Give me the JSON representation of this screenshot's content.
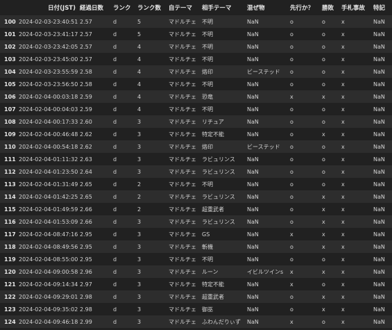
{
  "columns": [
    "",
    "日付(JST)",
    "経過日数",
    "ランク",
    "ランク数",
    "自テーマ",
    "相手テーマ",
    "混ぜ物",
    "先行か？",
    "勝敗",
    "手札事故",
    "特記"
  ],
  "rows": [
    [
      "100",
      "2024-02-03-23:40:51",
      "2.57",
      "d",
      "5",
      "マドルチェ",
      "不明",
      "NaN",
      "o",
      "o",
      "x",
      "NaN"
    ],
    [
      "101",
      "2024-02-03-23:41:17",
      "2.57",
      "d",
      "5",
      "マドルチェ",
      "不明",
      "NaN",
      "o",
      "o",
      "x",
      "NaN"
    ],
    [
      "102",
      "2024-02-03-23:42:05",
      "2.57",
      "d",
      "4",
      "マドルチェ",
      "不明",
      "NaN",
      "o",
      "o",
      "x",
      "NaN"
    ],
    [
      "103",
      "2024-02-03-23:45:00",
      "2.57",
      "d",
      "4",
      "マドルチェ",
      "不明",
      "NaN",
      "o",
      "o",
      "x",
      "NaN"
    ],
    [
      "104",
      "2024-02-03-23:55:59",
      "2.58",
      "d",
      "4",
      "マドルチェ",
      "烙印",
      "ビーステッド",
      "o",
      "o",
      "x",
      "NaN"
    ],
    [
      "105",
      "2024-02-03-23:56:50",
      "2.58",
      "d",
      "4",
      "マドルチェ",
      "不明",
      "NaN",
      "o",
      "o",
      "x",
      "NaN"
    ],
    [
      "106",
      "2024-02-04-00:03:18",
      "2.59",
      "d",
      "4",
      "マドルチェ",
      "恐竜",
      "NaN",
      "x",
      "x",
      "x",
      "NaN"
    ],
    [
      "107",
      "2024-02-04-00:04:03",
      "2.59",
      "d",
      "4",
      "マドルチェ",
      "不明",
      "NaN",
      "o",
      "o",
      "x",
      "NaN"
    ],
    [
      "108",
      "2024-02-04-00:17:33",
      "2.60",
      "d",
      "3",
      "マドルチェ",
      "リチュア",
      "NaN",
      "o",
      "o",
      "x",
      "NaN"
    ],
    [
      "109",
      "2024-02-04-00:46:48",
      "2.62",
      "d",
      "3",
      "マドルチェ",
      "特定不能",
      "NaN",
      "o",
      "x",
      "x",
      "NaN"
    ],
    [
      "110",
      "2024-02-04-00:54:18",
      "2.62",
      "d",
      "3",
      "マドルチェ",
      "烙印",
      "ビーステッド",
      "o",
      "o",
      "x",
      "NaN"
    ],
    [
      "111",
      "2024-02-04-01:11:32",
      "2.63",
      "d",
      "3",
      "マドルチェ",
      "ラビュリンス",
      "NaN",
      "o",
      "o",
      "x",
      "NaN"
    ],
    [
      "112",
      "2024-02-04-01:23:50",
      "2.64",
      "d",
      "3",
      "マドルチェ",
      "ラビュリンス",
      "NaN",
      "o",
      "o",
      "x",
      "NaN"
    ],
    [
      "113",
      "2024-02-04-01:31:49",
      "2.65",
      "d",
      "2",
      "マドルチェ",
      "不明",
      "NaN",
      "o",
      "o",
      "x",
      "NaN"
    ],
    [
      "114",
      "2024-02-04-01:42:25",
      "2.65",
      "d",
      "2",
      "マドルチェ",
      "ラビュリンス",
      "NaN",
      "o",
      "x",
      "x",
      "NaN"
    ],
    [
      "115",
      "2024-02-04-01:49:59",
      "2.66",
      "d",
      "2",
      "マドルチェ",
      "超重武者",
      "NaN",
      "o",
      "x",
      "x",
      "NaN"
    ],
    [
      "116",
      "2024-02-04-01:53:09",
      "2.66",
      "d",
      "3",
      "マドルチェ",
      "ラビュリンス",
      "NaN",
      "o",
      "x",
      "x",
      "NaN"
    ],
    [
      "117",
      "2024-02-04-08:47:16",
      "2.95",
      "d",
      "3",
      "マドルチェ",
      "GS",
      "NaN",
      "x",
      "x",
      "x",
      "NaN"
    ],
    [
      "118",
      "2024-02-04-08:49:56",
      "2.95",
      "d",
      "3",
      "マドルチェ",
      "斬機",
      "NaN",
      "o",
      "x",
      "x",
      "NaN"
    ],
    [
      "119",
      "2024-02-04-08:55:00",
      "2.95",
      "d",
      "3",
      "マドルチェ",
      "不明",
      "NaN",
      "o",
      "o",
      "x",
      "NaN"
    ],
    [
      "120",
      "2024-02-04-09:00:58",
      "2.96",
      "d",
      "3",
      "マドルチェ",
      "ルーン",
      "イビルツインs",
      "x",
      "x",
      "x",
      "NaN"
    ],
    [
      "121",
      "2024-02-04-09:14:34",
      "2.97",
      "d",
      "3",
      "マドルチェ",
      "特定不能",
      "NaN",
      "x",
      "o",
      "x",
      "NaN"
    ],
    [
      "122",
      "2024-02-04-09:29:01",
      "2.98",
      "d",
      "3",
      "マドルチェ",
      "超重武者",
      "NaN",
      "o",
      "x",
      "x",
      "NaN"
    ],
    [
      "123",
      "2024-02-04-09:35:02",
      "2.98",
      "d",
      "3",
      "マドルチェ",
      "御巫",
      "NaN",
      "o",
      "x",
      "x",
      "NaN"
    ],
    [
      "124",
      "2024-02-04-09:46:18",
      "2.99",
      "d",
      "3",
      "マドルチェ",
      "ふわんだりぃず",
      "NaN",
      "x",
      "o",
      "x",
      "NaN"
    ]
  ]
}
